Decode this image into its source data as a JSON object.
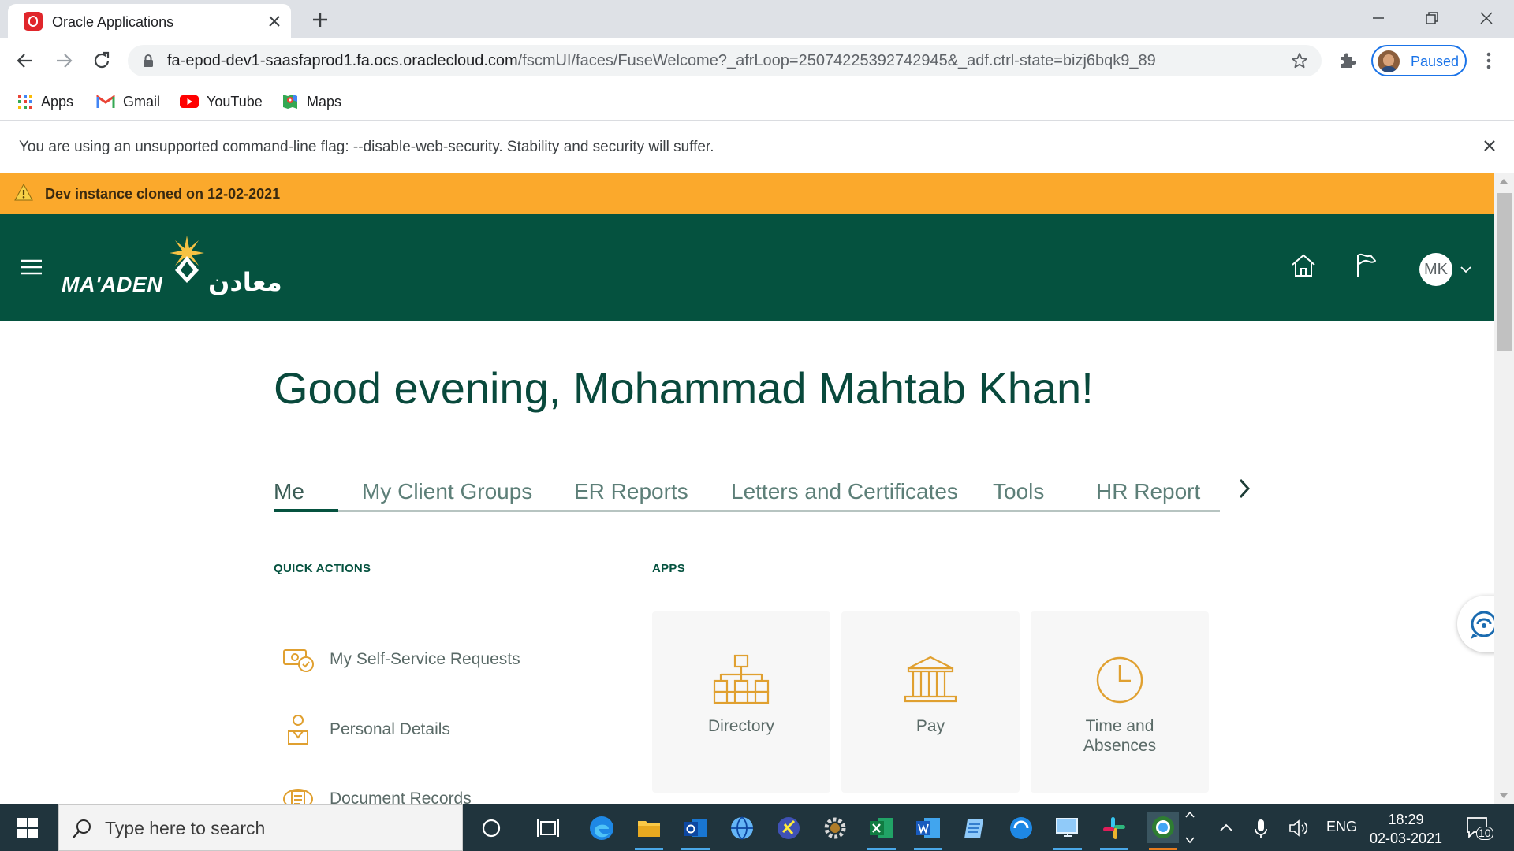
{
  "browser": {
    "tab_title": "Oracle Applications",
    "url_host": "fa-epod-dev1-saasfaprod1.fa.ocs.oraclecloud.com",
    "url_path": "/fscmUI/faces/FuseWelcome?_afrLoop=25074225392742945&_adf.ctrl-state=bizj6bqk9_89",
    "profile_label": "Paused",
    "bookmarks": [
      {
        "label": "Apps",
        "icon": "apps-grid-icon"
      },
      {
        "label": "Gmail",
        "icon": "gmail-icon"
      },
      {
        "label": "YouTube",
        "icon": "youtube-icon"
      },
      {
        "label": "Maps",
        "icon": "maps-icon"
      }
    ],
    "infobar_message": "You are using an unsupported command-line flag: --disable-web-security. Stability and security will suffer."
  },
  "app": {
    "dev_banner": "Dev instance cloned on 12-02-2021",
    "logo_text": "MA'ADEN",
    "logo_arabic": "معادن",
    "user_initials": "MK",
    "greeting": "Good evening, Mohammad Mahtab Khan!",
    "tabs": [
      {
        "label": "Me",
        "active": true
      },
      {
        "label": "My Client Groups",
        "active": false
      },
      {
        "label": "ER Reports",
        "active": false
      },
      {
        "label": "Letters and Certificates",
        "active": false
      },
      {
        "label": "Tools",
        "active": false
      },
      {
        "label": "HR Report",
        "active": false
      }
    ],
    "quick_actions_title": "QUICK ACTIONS",
    "quick_actions": [
      {
        "label": "My Self-Service Requests",
        "icon": "self-service-icon"
      },
      {
        "label": "Personal Details",
        "icon": "personal-details-icon"
      },
      {
        "label": "Document Records",
        "icon": "document-records-icon"
      }
    ],
    "apps_title": "APPS",
    "apps": [
      {
        "label": "Directory",
        "icon": "directory-icon"
      },
      {
        "label": "Pay",
        "icon": "pay-icon"
      },
      {
        "label": "Time and Absences",
        "icon": "clock-icon"
      }
    ]
  },
  "taskbar": {
    "search_placeholder": "Type here to search",
    "language": "ENG",
    "time": "18:29",
    "date": "02-03-2021",
    "notification_count": "10"
  },
  "colors": {
    "header_green": "#05523f",
    "dev_banner_orange": "#fba92c",
    "icon_gold": "#e0a030",
    "taskbar": "#20343d"
  }
}
